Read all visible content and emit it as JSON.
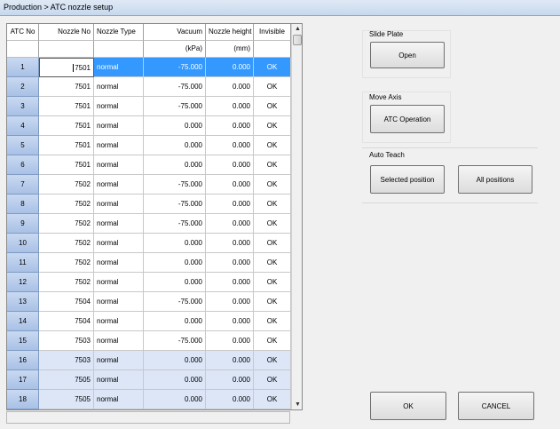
{
  "window": {
    "title": "Production > ATC nozzle setup"
  },
  "table": {
    "columns": [
      {
        "label": "ATC No",
        "unit": ""
      },
      {
        "label": "Nozzle No",
        "unit": ""
      },
      {
        "label": "Nozzle Type",
        "unit": ""
      },
      {
        "label": "Vacuum",
        "unit": "(kPa)"
      },
      {
        "label": "Nozzle height",
        "unit": "(mm)"
      },
      {
        "label": "Invisible",
        "unit": ""
      }
    ],
    "rows": [
      {
        "atc": "1",
        "nozzle": "7501",
        "type": "normal",
        "vacuum": "-75.000",
        "height": "0.000",
        "invisible": "OK"
      },
      {
        "atc": "2",
        "nozzle": "7501",
        "type": "normal",
        "vacuum": "-75.000",
        "height": "0.000",
        "invisible": "OK"
      },
      {
        "atc": "3",
        "nozzle": "7501",
        "type": "normal",
        "vacuum": "-75.000",
        "height": "0.000",
        "invisible": "OK"
      },
      {
        "atc": "4",
        "nozzle": "7501",
        "type": "normal",
        "vacuum": "0.000",
        "height": "0.000",
        "invisible": "OK"
      },
      {
        "atc": "5",
        "nozzle": "7501",
        "type": "normal",
        "vacuum": "0.000",
        "height": "0.000",
        "invisible": "OK"
      },
      {
        "atc": "6",
        "nozzle": "7501",
        "type": "normal",
        "vacuum": "0.000",
        "height": "0.000",
        "invisible": "OK"
      },
      {
        "atc": "7",
        "nozzle": "7502",
        "type": "normal",
        "vacuum": "-75.000",
        "height": "0.000",
        "invisible": "OK"
      },
      {
        "atc": "8",
        "nozzle": "7502",
        "type": "normal",
        "vacuum": "-75.000",
        "height": "0.000",
        "invisible": "OK"
      },
      {
        "atc": "9",
        "nozzle": "7502",
        "type": "normal",
        "vacuum": "-75.000",
        "height": "0.000",
        "invisible": "OK"
      },
      {
        "atc": "10",
        "nozzle": "7502",
        "type": "normal",
        "vacuum": "0.000",
        "height": "0.000",
        "invisible": "OK"
      },
      {
        "atc": "11",
        "nozzle": "7502",
        "type": "normal",
        "vacuum": "0.000",
        "height": "0.000",
        "invisible": "OK"
      },
      {
        "atc": "12",
        "nozzle": "7502",
        "type": "normal",
        "vacuum": "0.000",
        "height": "0.000",
        "invisible": "OK"
      },
      {
        "atc": "13",
        "nozzle": "7504",
        "type": "normal",
        "vacuum": "-75.000",
        "height": "0.000",
        "invisible": "OK"
      },
      {
        "atc": "14",
        "nozzle": "7504",
        "type": "normal",
        "vacuum": "0.000",
        "height": "0.000",
        "invisible": "OK"
      },
      {
        "atc": "15",
        "nozzle": "7503",
        "type": "normal",
        "vacuum": "-75.000",
        "height": "0.000",
        "invisible": "OK"
      },
      {
        "atc": "16",
        "nozzle": "7503",
        "type": "normal",
        "vacuum": "0.000",
        "height": "0.000",
        "invisible": "OK"
      },
      {
        "atc": "17",
        "nozzle": "7505",
        "type": "normal",
        "vacuum": "0.000",
        "height": "0.000",
        "invisible": "OK"
      },
      {
        "atc": "18",
        "nozzle": "7505",
        "type": "normal",
        "vacuum": "0.000",
        "height": "0.000",
        "invisible": "OK"
      }
    ]
  },
  "panel": {
    "slide_plate": {
      "label": "Slide Plate",
      "open_button": "Open"
    },
    "move_axis": {
      "label": "Move Axis",
      "atc_button": "ATC Operation"
    },
    "auto_teach": {
      "label": "Auto Teach",
      "selected_button": "Selected position",
      "all_button": "All positions"
    }
  },
  "footer": {
    "ok_button": "OK",
    "cancel_button": "CANCEL"
  },
  "colors": {
    "selection": "#3399ff",
    "row_header": "#b9cdec",
    "alt_row": "#dce6f7"
  }
}
